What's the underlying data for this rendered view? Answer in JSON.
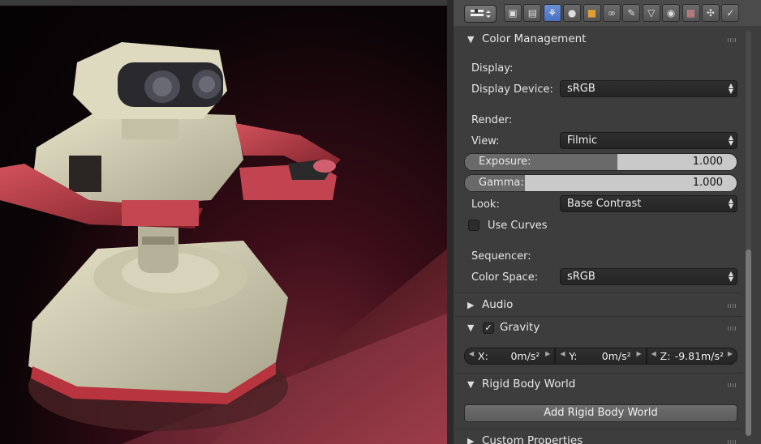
{
  "properties": {
    "tabs": [
      {
        "icon": "camera-render-icon"
      },
      {
        "icon": "render-layers-icon"
      },
      {
        "icon": "scene-icon",
        "active": true
      },
      {
        "icon": "world-icon"
      },
      {
        "icon": "object-icon"
      },
      {
        "icon": "constraints-icon"
      },
      {
        "icon": "modifiers-wrench-icon"
      },
      {
        "icon": "object-data-icon"
      },
      {
        "icon": "material-icon"
      },
      {
        "icon": "texture-icon"
      },
      {
        "icon": "particles-icon"
      },
      {
        "icon": "physics-icon"
      }
    ],
    "color_management": {
      "title": "Color Management",
      "display_label": "Display:",
      "display_device_label": "Display Device:",
      "display_device_value": "sRGB",
      "render_label": "Render:",
      "view_label": "View:",
      "view_value": "Filmic",
      "exposure_label": "Exposure:",
      "exposure_value": "1.000",
      "gamma_label": "Gamma:",
      "gamma_value": "1.000",
      "look_label": "Look:",
      "look_value": "Base Contrast",
      "use_curves_label": "Use Curves",
      "use_curves_checked": false,
      "sequencer_label": "Sequencer:",
      "color_space_label": "Color Space:",
      "color_space_value": "sRGB"
    },
    "audio": {
      "title": "Audio"
    },
    "gravity": {
      "title": "Gravity",
      "enabled": true,
      "x_label": "X:",
      "x_value": "0m/s²",
      "y_label": "Y:",
      "y_value": "0m/s²",
      "z_label": "Z:",
      "z_value": "-9.81m/s²"
    },
    "rigid_body_world": {
      "title": "Rigid Body World",
      "add_button": "Add Rigid Body World"
    },
    "custom_properties": {
      "title": "Custom Properties"
    }
  },
  "colors": {
    "active_tab": "#5680d0",
    "panel_bg": "#3d3d3d",
    "header_bg": "#4b4b4b"
  }
}
